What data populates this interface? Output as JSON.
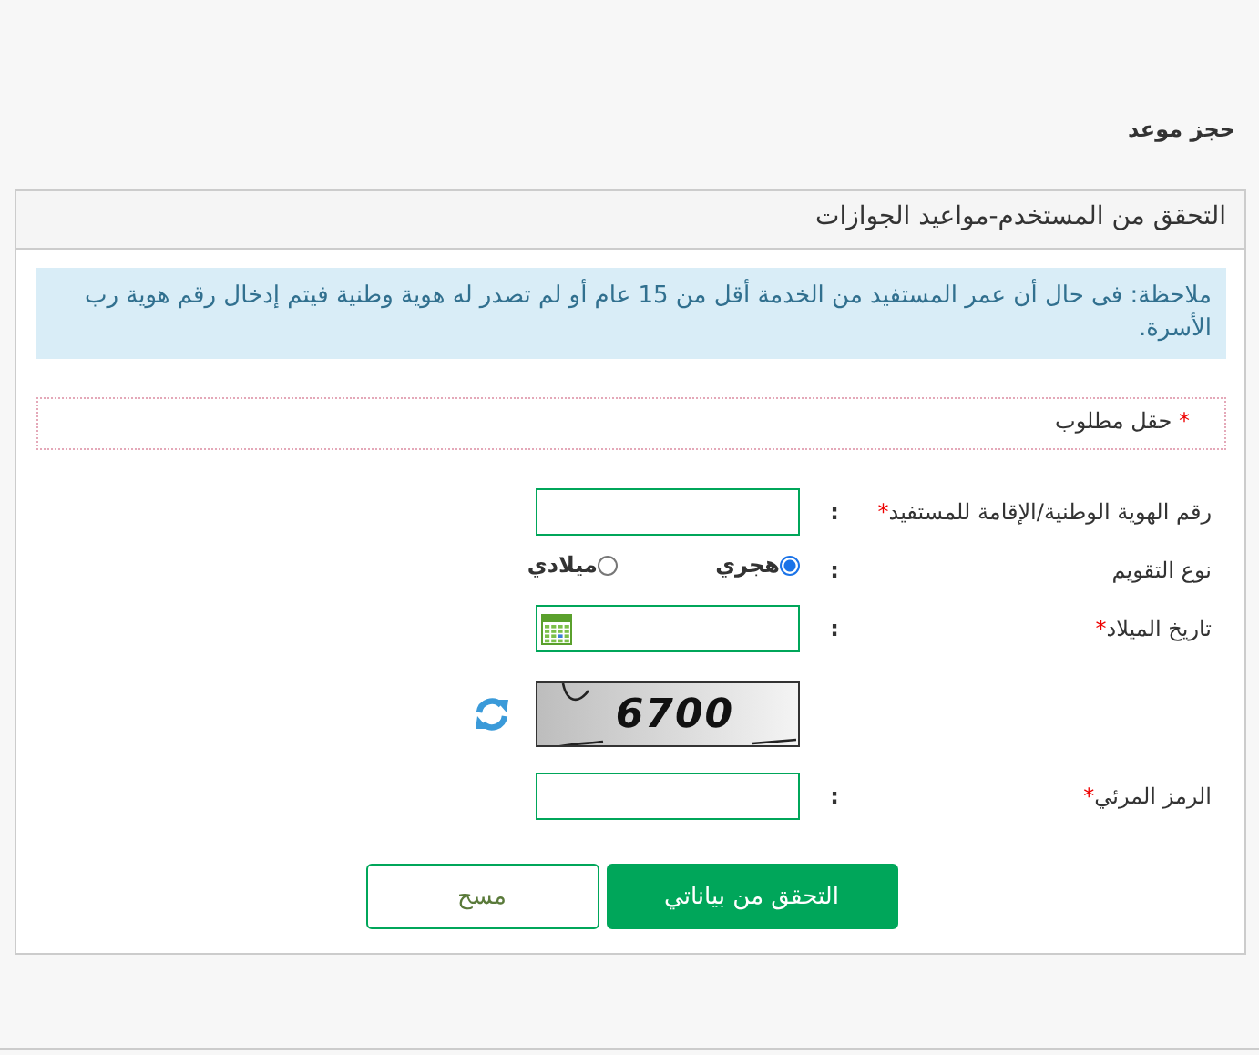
{
  "breadcrumb": "حجز موعد",
  "panel": {
    "title": "التحقق من المستخدم-مواعيد الجوازات",
    "note": "ملاحظة: فى حال أن عمر المستفيد من الخدمة أقل من 15 عام أو لم تصدر له هوية وطنية فيتم إدخال رقم هوية رب الأسرة.",
    "required_hint": {
      "mark": "*",
      "text": "حقل مطلوب"
    }
  },
  "fields": [
    {
      "kind": "text",
      "label": "رقم الهوية الوطنية/الإقامة للمستفيد",
      "required_mark": "*",
      "colon": ":"
    },
    {
      "kind": "radio",
      "label": "نوع التقويم",
      "colon": ":",
      "options": [
        {
          "label": "هجري",
          "selected": true
        },
        {
          "label": "ميلادي",
          "selected": false
        }
      ]
    },
    {
      "kind": "date",
      "label": "تاريخ الميلاد",
      "required_mark": "*",
      "colon": ":"
    },
    {
      "kind": "captcha",
      "code": "6700"
    },
    {
      "kind": "text",
      "label": "الرمز المرئي",
      "required_mark": "*",
      "colon": ":"
    }
  ],
  "buttons": [
    {
      "kind": "primary",
      "label": "التحقق من بياناتي"
    },
    {
      "kind": "secondary",
      "label": "مسح"
    }
  ]
}
